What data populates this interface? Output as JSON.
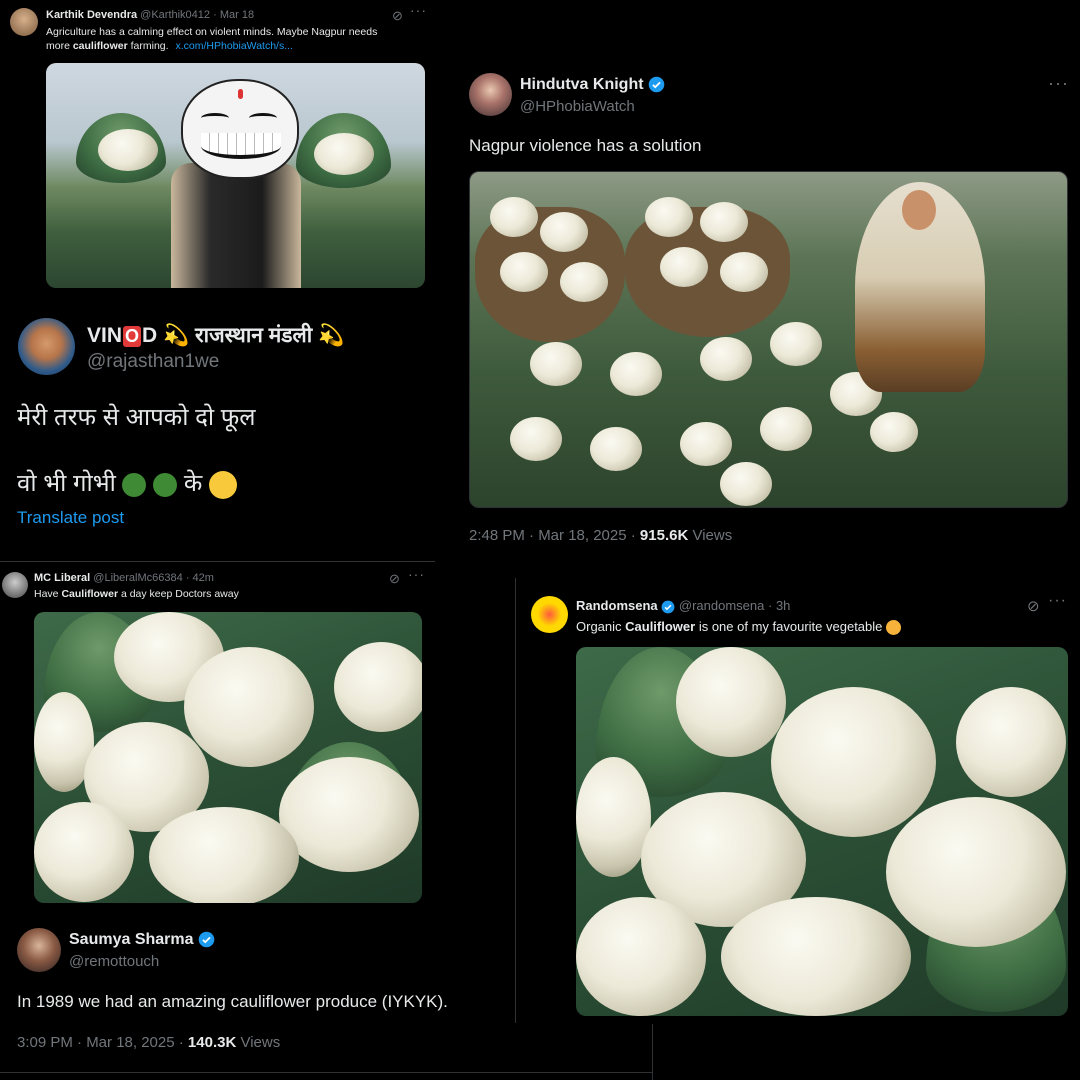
{
  "tweet1": {
    "name": "Karthik Devendra",
    "handle": "@Karthik0412",
    "dot": "·",
    "date": "Mar 18",
    "text1": "Agriculture has a calming effect on violent minds. Maybe Nagpur needs",
    "text2a": "more ",
    "text2b": "cauliflower",
    "text2c": " farming.",
    "link": "x.com/HPhobiaWatch/s..."
  },
  "tweet2": {
    "name_a": "VIN",
    "name_o": "O",
    "name_b": "D",
    "name_c": "राजस्थान मंडली",
    "handle": "@rajasthan1we",
    "line1": "मेरी तरफ से आपको दो फूल",
    "line2": "वो भी गोभी",
    "line2b": "के",
    "translate": "Translate post"
  },
  "tweet3": {
    "name": "Hindutva Knight",
    "handle": "@HPhobiaWatch",
    "text": "Nagpur violence has a solution",
    "time": "2:48 PM · Mar 18, 2025 · ",
    "views_count": "915.6K",
    "views_label": " Views"
  },
  "tweet4": {
    "name": "MC Liberal",
    "handle": "@LiberalMc66384",
    "dot": "·",
    "age": "42m",
    "text_a": "Have ",
    "text_b": "Cauliflower",
    "text_c": " a day keep Doctors away"
  },
  "tweet5": {
    "name": "Randomsena",
    "handle": "@randomsena",
    "dot": "·",
    "age": "3h",
    "text_a": "Organic ",
    "text_b": "Cauliflower",
    "text_c": " is one of my favourite vegetable"
  },
  "tweet6": {
    "name": "Saumya Sharma",
    "handle": "@remottouch",
    "text": "In 1989 we had an amazing cauliflower produce (IYKYK).",
    "time": "3:09 PM · Mar 18, 2025 · ",
    "views_count": "140.3K",
    "views_label": " Views"
  },
  "icons": {
    "more": "more-icon",
    "grok": "grok-icon",
    "verified": "verified-badge-icon"
  },
  "colors": {
    "background": "#000000",
    "text": "#e7e9ea",
    "muted": "#71767b",
    "link": "#1d9bf0",
    "divider": "#2f3336"
  }
}
